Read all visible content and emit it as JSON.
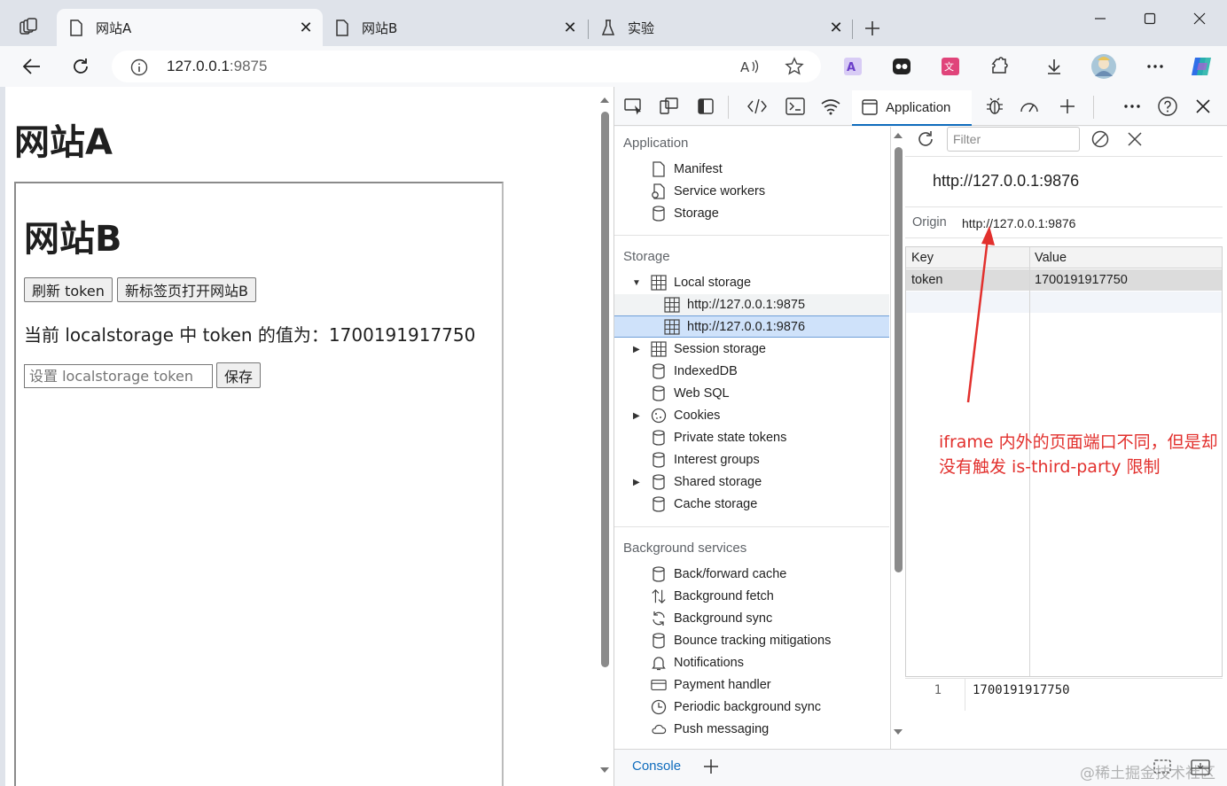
{
  "browser": {
    "tabs": [
      {
        "label": "网站A",
        "active": true
      },
      {
        "label": "网站B",
        "active": false
      },
      {
        "label": "实验",
        "active": false
      }
    ],
    "address": {
      "host": "127.0.0.1",
      "port": ":9875"
    }
  },
  "page": {
    "title_a": "网站A",
    "iframe": {
      "title_b": "网站B",
      "refresh_button": "刷新 token",
      "open_button": "新标签页打开网站B",
      "token_line": "当前 localstorage 中 token 的值为：1700191917750",
      "input_placeholder": "设置 localstorage token",
      "save_button": "保存"
    }
  },
  "devtools": {
    "active_tab": "Application",
    "sidebar": {
      "application_header": "Application",
      "application_items": [
        "Manifest",
        "Service workers",
        "Storage"
      ],
      "storage_header": "Storage",
      "local_storage": "Local storage",
      "local_origins": [
        "http://127.0.0.1:9875",
        "http://127.0.0.1:9876"
      ],
      "storage_items": [
        "Session storage",
        "IndexedDB",
        "Web SQL",
        "Cookies",
        "Private state tokens",
        "Interest groups",
        "Shared storage",
        "Cache storage"
      ],
      "background_header": "Background services",
      "background_items": [
        "Back/forward cache",
        "Background fetch",
        "Background sync",
        "Bounce tracking mitigations",
        "Notifications",
        "Payment handler",
        "Periodic background sync",
        "Push messaging"
      ]
    },
    "main": {
      "filter_placeholder": "Filter",
      "origin_title": "http://127.0.0.1:9876",
      "origin_label": "Origin",
      "origin_value": "http://127.0.0.1:9876",
      "columns": [
        "Key",
        "Value"
      ],
      "rows": [
        {
          "key": "token",
          "value": "1700191917750"
        }
      ],
      "preview_line": "1",
      "preview_value": "1700191917750"
    },
    "annotation": "iframe 内外的页面端口不同，但是却没有触发 is-third-party 限制",
    "drawer_tab": "Console"
  },
  "watermark": "@稀土掘金技术社区",
  "colors": {
    "accent": "#0f6cbd",
    "annotation": "#e2302d",
    "selection": "#cfe2fa"
  }
}
